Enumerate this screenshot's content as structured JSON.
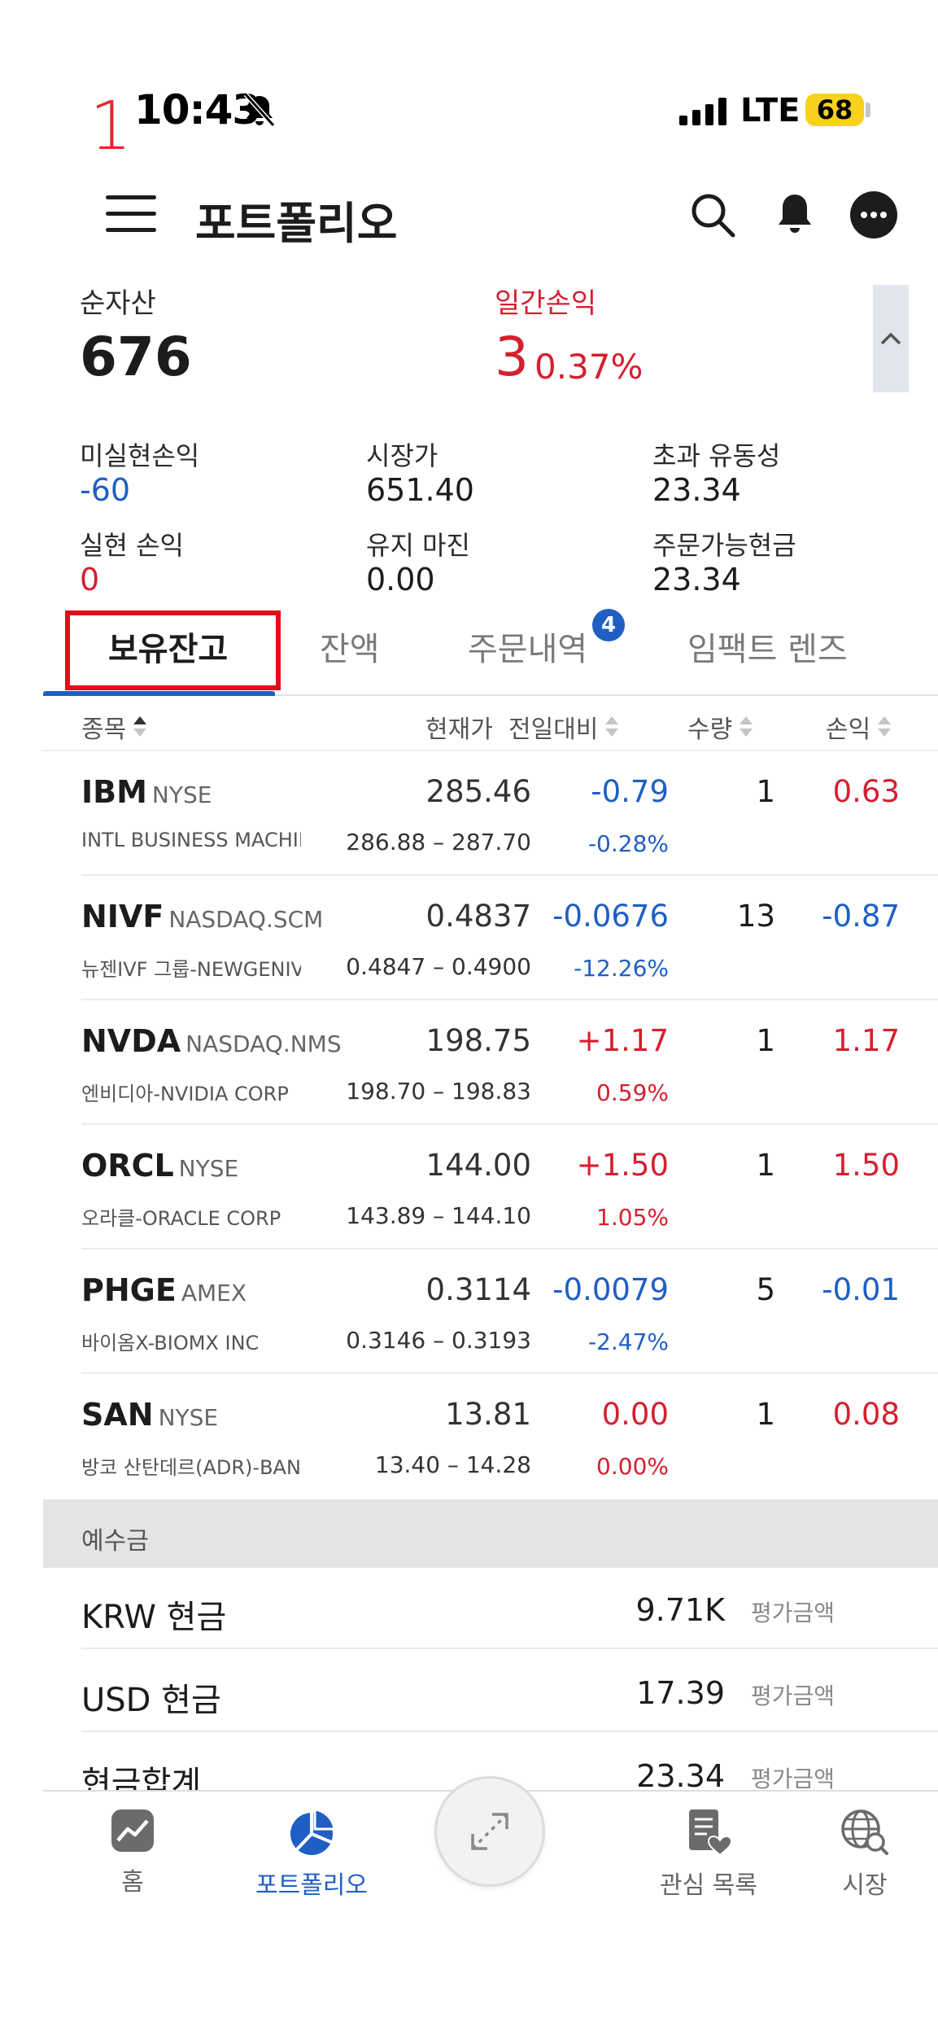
{
  "status_bar": {
    "annotation_number": "1",
    "time": "10:43",
    "network": "LTE",
    "battery": "68"
  },
  "header": {
    "title": "포트폴리오"
  },
  "summary": {
    "net_assets_label": "순자산",
    "net_assets_value": "676",
    "daily_pl_label": "일간손익",
    "daily_pl_value": "3",
    "daily_pl_percent": "0.37%"
  },
  "metrics": [
    {
      "label": "미실현손익",
      "value": "-60",
      "color": "blue"
    },
    {
      "label": "시장가",
      "value": "651.40",
      "color": "default"
    },
    {
      "label": "초과 유동성",
      "value": "23.34",
      "color": "default"
    },
    {
      "label": "실현 손익",
      "value": "0",
      "color": "red"
    },
    {
      "label": "유지 마진",
      "value": "0.00",
      "color": "default"
    },
    {
      "label": "주문가능현금",
      "value": "23.34",
      "color": "default"
    }
  ],
  "tabs": [
    {
      "label": "보유잔고",
      "active": true
    },
    {
      "label": "잔액",
      "active": false
    },
    {
      "label": "주문내역",
      "active": false,
      "badge": "4"
    },
    {
      "label": "임팩트 렌즈",
      "active": false
    }
  ],
  "table": {
    "columns": [
      "종목",
      "현재가",
      "전일대비",
      "수량",
      "손익"
    ],
    "rows": [
      {
        "symbol": "IBM",
        "exchange": "NYSE",
        "name": "INTL BUSINESS MACHIN...",
        "price": "285.46",
        "range": "286.88 – 287.70",
        "change": "-0.79",
        "change_pct": "-0.28%",
        "qty": "1",
        "pl": "0.63",
        "change_dir": "down",
        "pl_dir": "up"
      },
      {
        "symbol": "NIVF",
        "exchange": "NASDAQ.SCM",
        "name": "뉴젠IVF 그룹-NEWGENIV...",
        "price": "0.4837",
        "range": "0.4847 – 0.4900",
        "change": "-0.0676",
        "change_pct": "-12.26%",
        "qty": "13",
        "pl": "-0.87",
        "change_dir": "down",
        "pl_dir": "down"
      },
      {
        "symbol": "NVDA",
        "exchange": "NASDAQ.NMS",
        "name": "엔비디아-NVIDIA CORP",
        "price": "198.75",
        "range": "198.70 – 198.83",
        "change": "+1.17",
        "change_pct": "0.59%",
        "qty": "1",
        "pl": "1.17",
        "change_dir": "up",
        "pl_dir": "up"
      },
      {
        "symbol": "ORCL",
        "exchange": "NYSE",
        "name": "오라클-ORACLE CORP",
        "price": "144.00",
        "range": "143.89 – 144.10",
        "change": "+1.50",
        "change_pct": "1.05%",
        "qty": "1",
        "pl": "1.50",
        "change_dir": "up",
        "pl_dir": "up"
      },
      {
        "symbol": "PHGE",
        "exchange": "AMEX",
        "name": "바이옴X-BIOMX INC",
        "price": "0.3114",
        "range": "0.3146 – 0.3193",
        "change": "-0.0079",
        "change_pct": "-2.47%",
        "qty": "5",
        "pl": "-0.01",
        "change_dir": "down",
        "pl_dir": "down"
      },
      {
        "symbol": "SAN",
        "exchange": "NYSE",
        "name": "방코 산탄데르(ADR)-BAN...",
        "price": "13.81",
        "range": "13.40 – 14.28",
        "change": "0.00",
        "change_pct": "0.00%",
        "qty": "1",
        "pl": "0.08",
        "change_dir": "up",
        "pl_dir": "up"
      }
    ]
  },
  "deposit": {
    "section_label": "예수금",
    "rows": [
      {
        "name": "KRW 현금",
        "value": "9.71K",
        "note": "평가금액"
      },
      {
        "name": "USD 현금",
        "value": "17.39",
        "note": "평가금액"
      },
      {
        "name": "현금합계",
        "value": "23.34",
        "note": "평가금액"
      }
    ]
  },
  "bottom_nav": [
    {
      "label": "홈",
      "icon": "chart-icon",
      "active": false
    },
    {
      "label": "포트폴리오",
      "icon": "pie-chart-icon",
      "active": true
    },
    {
      "label": "관심 목록",
      "icon": "watchlist-icon",
      "active": false
    },
    {
      "label": "시장",
      "icon": "globe-search-icon",
      "active": false
    }
  ],
  "colors": {
    "red": "#d61f2f",
    "blue": "#1f5fc4",
    "annotation": "#e30d18"
  }
}
